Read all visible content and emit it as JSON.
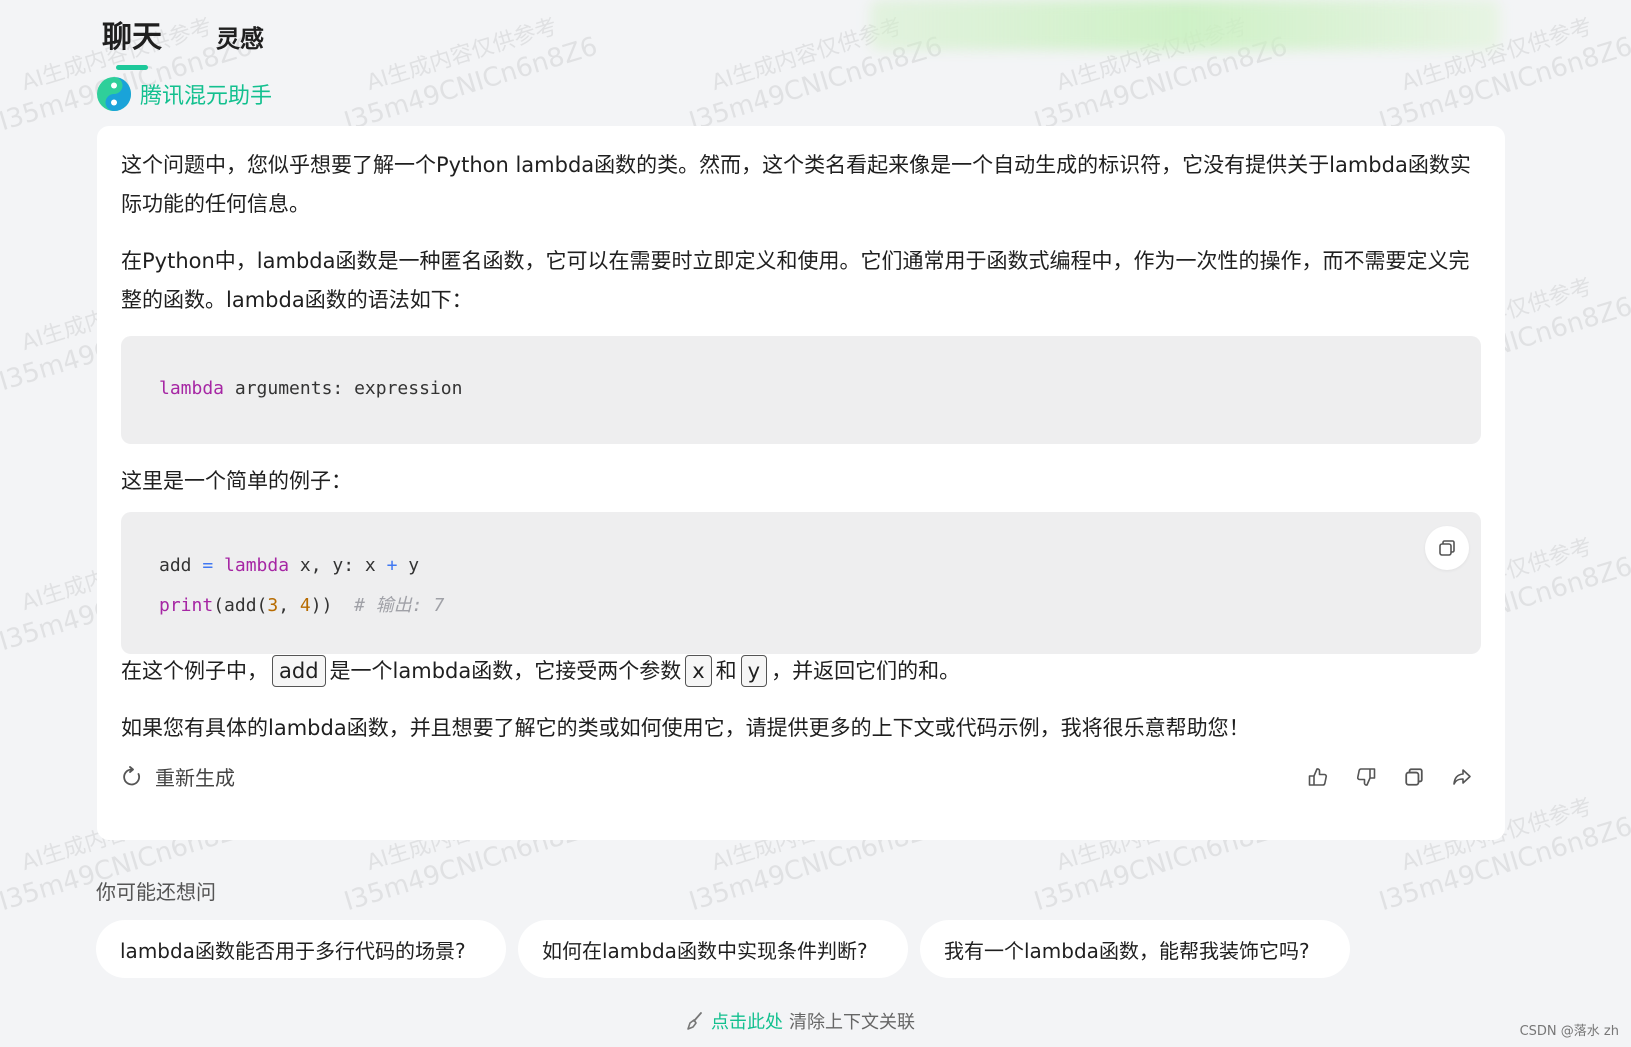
{
  "tabs": [
    {
      "label": "聊天",
      "active": true
    },
    {
      "label": "灵感",
      "active": false
    }
  ],
  "assistant": {
    "name": "腾讯混元助手"
  },
  "answer": {
    "p1": "这个问题中，您似乎想要了解一个Python lambda函数的类。然而，这个类名看起来像是一个自动生成的标识符，它没有提供关于lambda函数实际功能的任何信息。",
    "p2": "在Python中，lambda函数是一种匿名函数，它可以在需要时立即定义和使用。它们通常用于函数式编程中，作为一次性的操作，而不需要定义完整的函数。lambda函数的语法如下：",
    "code1": {
      "keyword": "lambda",
      "rest": " arguments: expression"
    },
    "p3": "这里是一个简单的例子：",
    "code2": {
      "l1_var": "add",
      "l1_eq": " = ",
      "l1_kw": "lambda",
      "l1_args": " x, y: x ",
      "l1_plus": "+",
      "l1_end": " y",
      "l2_kw": "print",
      "l2_a": "(add(",
      "l2_n1": "3",
      "l2_b": ", ",
      "l2_n2": "4",
      "l2_c": "))  ",
      "l2_comment": "# 输出: 7"
    },
    "p4": {
      "a": "在这个例子中，",
      "code_add": "add",
      "b": "是一个lambda函数，它接受两个参数",
      "code_x": "x",
      "c": "和",
      "code_y": "y",
      "d": "，并返回它们的和。"
    },
    "p5": "如果您有具体的lambda函数，并且想要了解它的类或如何使用它，请提供更多的上下文或代码示例，我将很乐意帮助您！",
    "regenerate_label": "重新生成"
  },
  "icons": [
    "refresh-icon",
    "thumbs-up-icon",
    "thumbs-down-icon",
    "copy-icon",
    "share-icon",
    "broom-icon"
  ],
  "colors": {
    "accent": "#13c08f",
    "background": "#f3f4f6",
    "card": "#ffffff",
    "code_bg": "#eeeeef"
  },
  "maybe_title": "你可能还想问",
  "suggestions": [
    "lambda函数能否用于多行代码的场景?",
    "如何在lambda函数中实现条件判断?",
    "我有一个lambda函数，能帮我装饰它吗?"
  ],
  "clear": {
    "link": "点击此处",
    "rest": "清除上下文关联"
  },
  "credit": "CSDN @落水 zh",
  "watermark": {
    "line1": "AI生成内容仅供参考",
    "line2": "I35m49CNICn6n8Z6"
  }
}
